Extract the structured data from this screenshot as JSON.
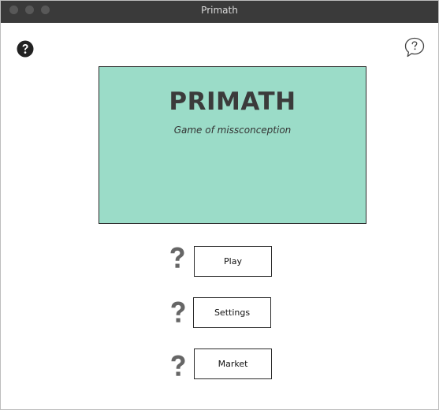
{
  "window": {
    "title": "Primath"
  },
  "banner": {
    "title": "PRIMATH",
    "subtitle": "Game of missconception"
  },
  "menu": {
    "items": [
      {
        "label": "Play",
        "help_icon": "question-mark-icon"
      },
      {
        "label": "Settings",
        "help_icon": "question-mark-icon"
      },
      {
        "label": "Market",
        "help_icon": "question-mark-icon"
      }
    ]
  },
  "icons": {
    "help": "question-circle-icon",
    "feedback": "speech-bubble-question-icon"
  },
  "colors": {
    "titlebar": "#3a3a3a",
    "banner_bg": "#9bdcc8",
    "icon_gray": "#666666"
  }
}
